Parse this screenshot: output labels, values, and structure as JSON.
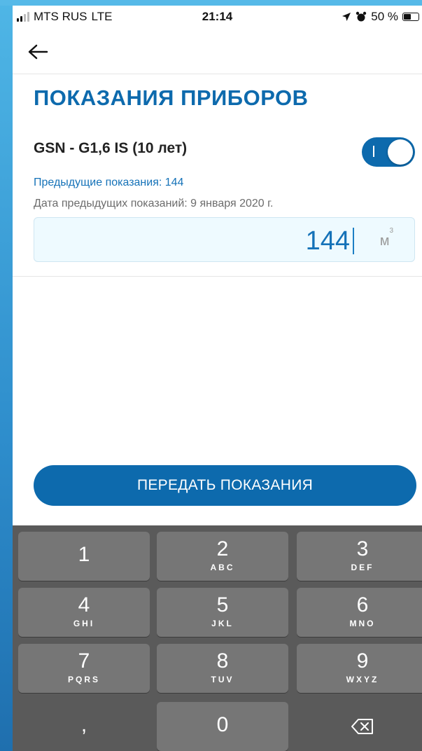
{
  "status_bar": {
    "carrier": "MTS RUS",
    "network": "LTE",
    "time": "21:14",
    "battery": "50 %"
  },
  "nav": {
    "back_icon": "arrow-left-icon"
  },
  "page": {
    "title": "ПОКАЗАНИЯ ПРИБОРОВ",
    "meter_name": "GSN - G1,6 IS (10 лет)",
    "toggle_on": true,
    "previous_reading": "Предыдущие показания: 144",
    "previous_date": "Дата предыдущих показаний: 9 января 2020 г.",
    "reading_value": "144",
    "unit": "м",
    "unit_sup": "3"
  },
  "submit_label": "ПЕРЕДАТЬ ПОКАЗАНИЯ",
  "keypad": {
    "keys": [
      {
        "digit": "1",
        "letters": ""
      },
      {
        "digit": "2",
        "letters": "ABC"
      },
      {
        "digit": "3",
        "letters": "DEF"
      },
      {
        "digit": "4",
        "letters": "GHI"
      },
      {
        "digit": "5",
        "letters": "JKL"
      },
      {
        "digit": "6",
        "letters": "MNO"
      },
      {
        "digit": "7",
        "letters": "PQRS"
      },
      {
        "digit": "8",
        "letters": "TUV"
      },
      {
        "digit": "9",
        "letters": "WXYZ"
      },
      {
        "digit": ",",
        "letters": ""
      },
      {
        "digit": "0",
        "letters": ""
      }
    ],
    "delete_icon": "backspace-icon"
  },
  "colors": {
    "brand": "#0d6aad",
    "link": "#1572b8",
    "field_bg": "#eefaff",
    "keypad_bg": "#5a5a5a",
    "key_bg": "#767676"
  }
}
